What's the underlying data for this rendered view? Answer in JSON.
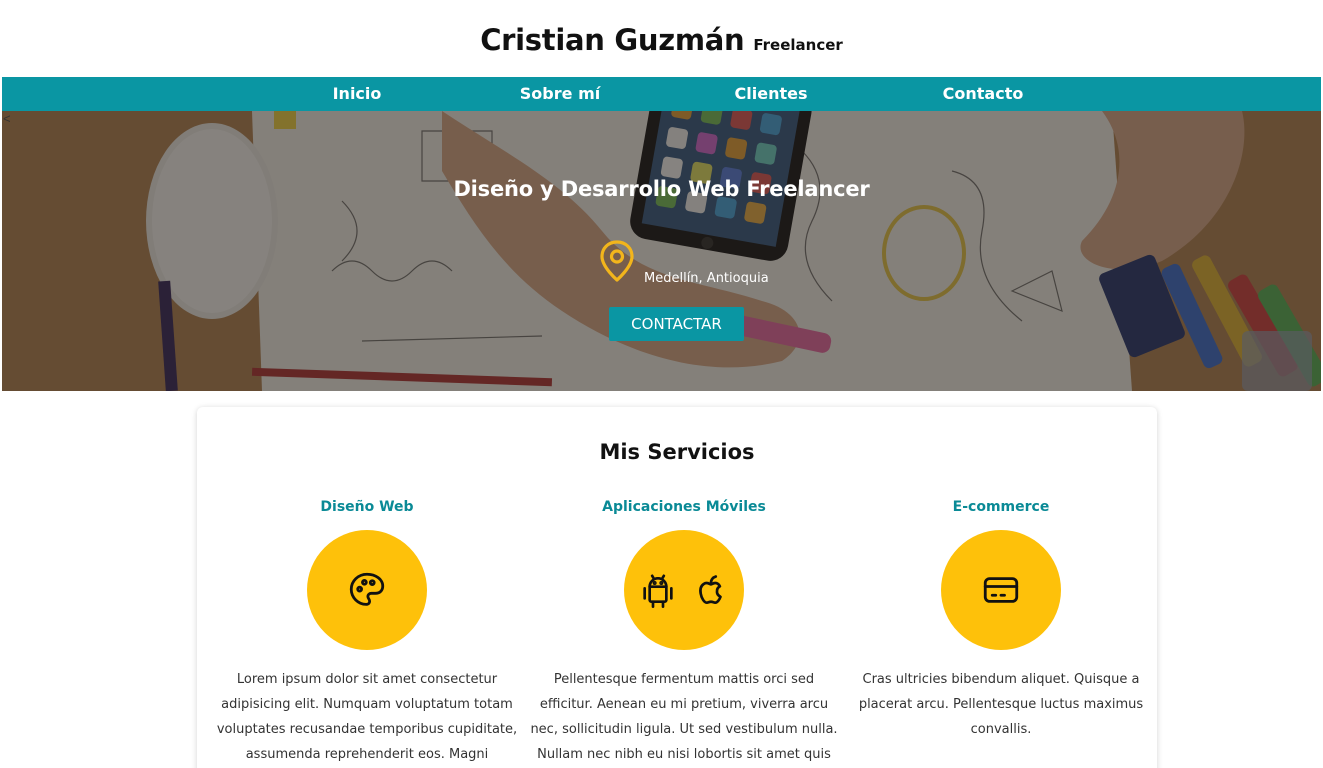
{
  "header": {
    "title": "Cristian Guzmán",
    "subtitle": "Freelancer"
  },
  "nav": {
    "items": [
      {
        "label": "Inicio"
      },
      {
        "label": "Sobre mí"
      },
      {
        "label": "Clientes"
      },
      {
        "label": "Contacto"
      }
    ]
  },
  "hero": {
    "arrow": "<",
    "title": "Diseño y Desarrollo Web Freelancer",
    "location": "Medellín, Antioquia",
    "location_icon": "map-pin-icon",
    "button_label": "CONTACTAR"
  },
  "services": {
    "title": "Mis Servicios",
    "items": [
      {
        "heading": "Diseño Web",
        "icons": [
          "palette-icon"
        ],
        "text": "Lorem ipsum dolor sit amet consectetur adipisicing elit. Numquam voluptatum totam voluptates recusandae temporibus cupiditate, assumenda reprehenderit eos. Magni consequatur rerum ipsa"
      },
      {
        "heading": "Aplicaciones Móviles",
        "icons": [
          "android-icon",
          "apple-icon"
        ],
        "text": "Pellentesque fermentum mattis orci sed efficitur. Aenean eu mi pretium, viverra arcu nec, sollicitudin ligula. Ut sed vestibulum nulla. Nullam nec nibh eu nisi lobortis sit amet quis felis."
      },
      {
        "heading": "E-commerce",
        "icons": [
          "credit-card-icon"
        ],
        "text": "Cras ultricies bibendum aliquet. Quisque a placerat arcu. Pellentesque luctus maximus convallis."
      }
    ]
  },
  "colors": {
    "primary": "#0a96a3",
    "accent": "#fec10a",
    "heading_teal": "#0a8a96"
  }
}
